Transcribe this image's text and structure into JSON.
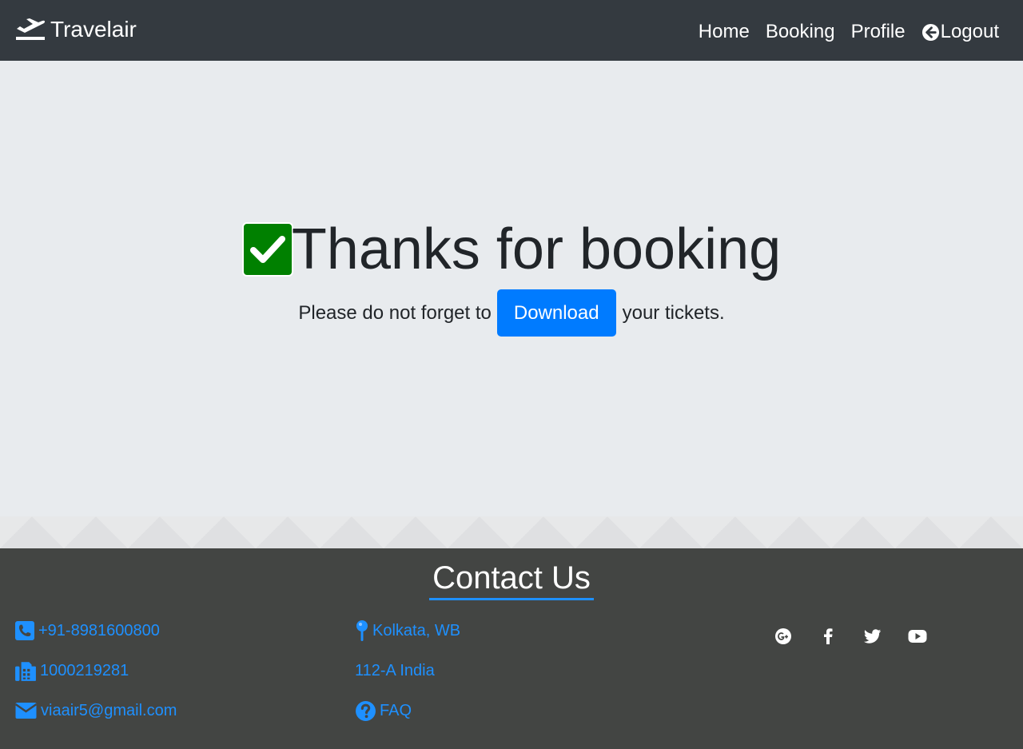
{
  "navbar": {
    "brand": "Travelair",
    "brand_icon": "plane-departure-icon",
    "links": [
      "Home",
      "Booking",
      "Profile"
    ],
    "logout_label": "Logout",
    "logout_icon": "arrow-circle-left-icon"
  },
  "main": {
    "title": "Thanks for booking",
    "title_icon": "check-square-icon",
    "subtitle_before": "Please do not forget to",
    "download_label": "Download",
    "subtitle_after": "your tickets."
  },
  "footer": {
    "heading": "Contact Us",
    "contacts": [
      {
        "icon": "phone-icon",
        "text": "+91-8981600800"
      },
      {
        "icon": "fax-icon",
        "text": "1000219281"
      },
      {
        "icon": "envelope-icon",
        "text": "viaair5@gmail.com"
      }
    ],
    "address": [
      {
        "icon": "map-pin-icon",
        "text": "Kolkata, WB"
      },
      {
        "icon": "",
        "text": "112-A India"
      },
      {
        "icon": "question-circle-icon",
        "text": "FAQ"
      }
    ],
    "social": [
      "google-plus-icon",
      "facebook-icon",
      "twitter-icon",
      "youtube-icon"
    ]
  },
  "colors": {
    "navbar_bg": "#343a40",
    "main_bg": "#e8ebee",
    "footer_bg": "#434543",
    "accent": "#1e90ff",
    "button": "#007bff",
    "check_green": "#008000"
  }
}
